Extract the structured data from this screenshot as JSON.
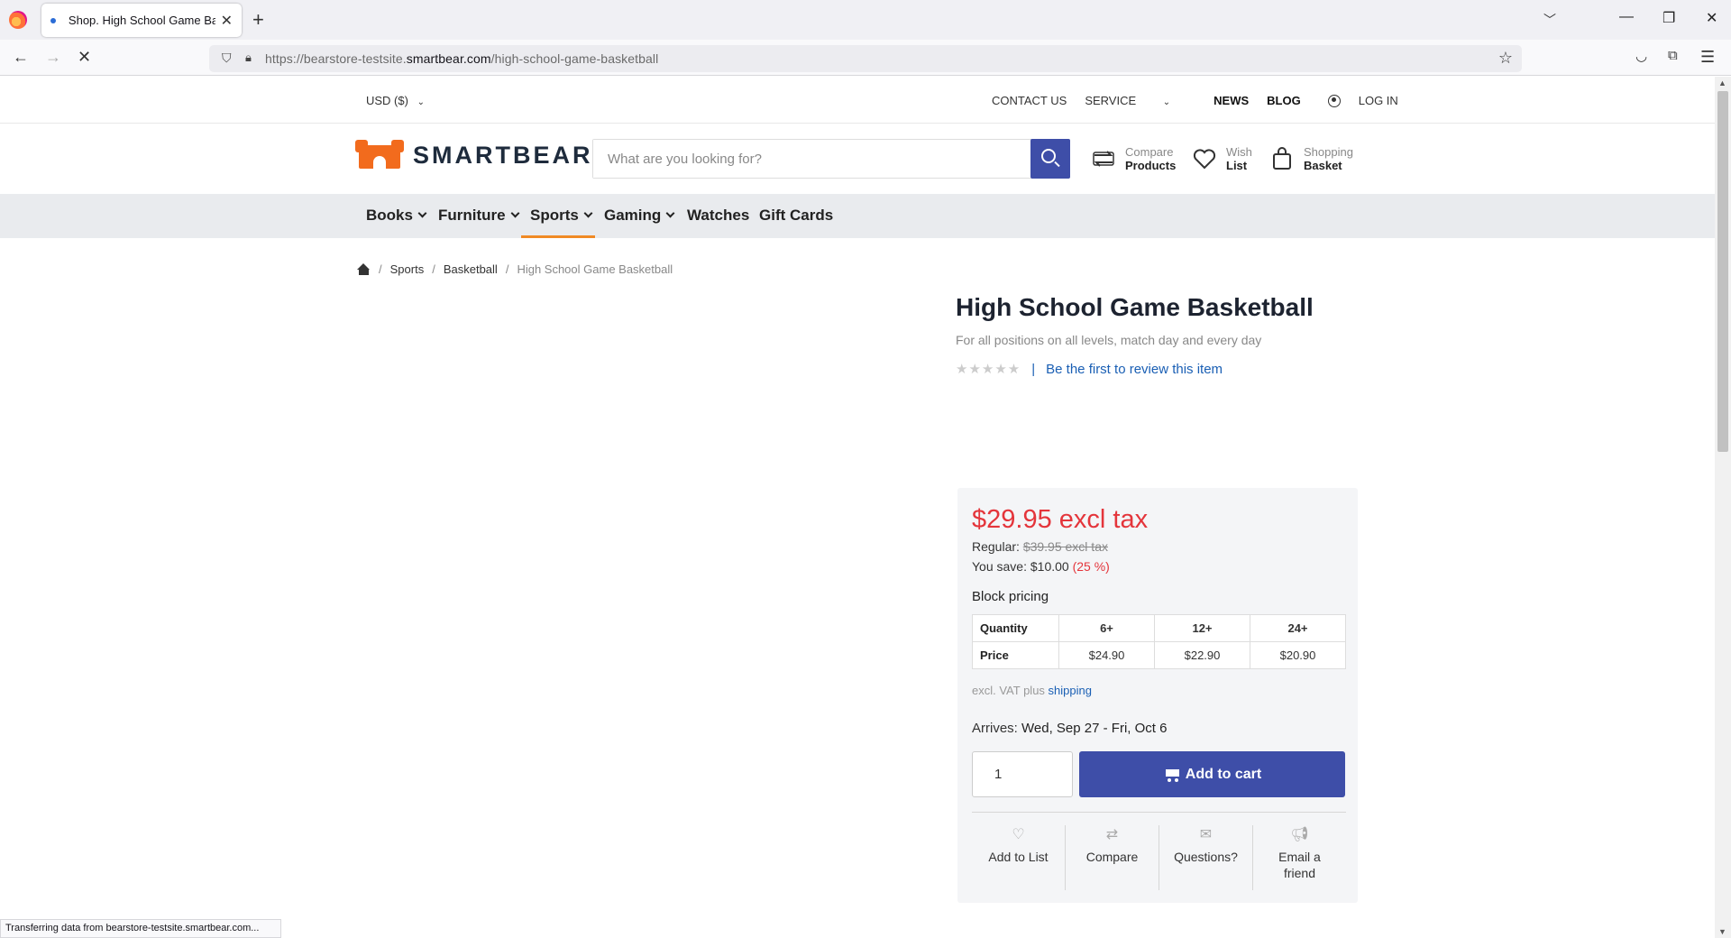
{
  "browser": {
    "tab_title": "Shop. High School Game Basketball",
    "url_prefix": "https://bearstore-testsite.",
    "url_domain": "smartbear.com",
    "url_path": "/high-school-game-basketball",
    "status_text": "Transferring data from bearstore-testsite.smartbear.com..."
  },
  "topbar": {
    "currency": "USD ($)",
    "contact": "CONTACT US",
    "service": "SERVICE",
    "news": "NEWS",
    "blog": "BLOG",
    "login": "LOG IN"
  },
  "header": {
    "logo_text": "SMARTBEAR",
    "search_placeholder": "What are you looking for?",
    "compare_l1": "Compare",
    "compare_l2": "Products",
    "wish_l1": "Wish",
    "wish_l2": "List",
    "basket_l1": "Shopping",
    "basket_l2": "Basket"
  },
  "categories": [
    "Books",
    "Furniture",
    "Sports",
    "Gaming",
    "Watches",
    "Gift Cards"
  ],
  "active_category": "Sports",
  "breadcrumb": [
    "Sports",
    "Basketball",
    "High School Game Basketball"
  ],
  "product": {
    "title": "High School Game Basketball",
    "subtitle": "For all positions on all levels, match day and every day",
    "rating": 0,
    "review_link": "Be the first to review this item",
    "price": "$29.95 excl tax",
    "regular_label": "Regular:",
    "regular_price": "$39.95 excl tax",
    "save_label": "You save:",
    "save_amount": "$10.00",
    "save_pct": "(25 %)",
    "block_pricing_title": "Block pricing",
    "tiers_header": [
      "Quantity",
      "6+",
      "12+",
      "24+"
    ],
    "tiers_price": [
      "Price",
      "$24.90",
      "$22.90",
      "$20.90"
    ],
    "vat_text": "excl. VAT plus",
    "shipping_link": "shipping",
    "arrives_label": "Arrives:",
    "arrives_value": "Wed, Sep 27 - Fri, Oct 6",
    "quantity": "1",
    "add_to_cart": "Add to cart",
    "actions": {
      "add_to_list": "Add to List",
      "compare": "Compare",
      "questions": "Questions?",
      "email_friend": "Email a friend"
    }
  },
  "colors": {
    "brand_orange": "#f26b1d",
    "primary_blue": "#3e4ea8",
    "price_red": "#e4353b",
    "link_blue": "#1a5fb4",
    "nav_bg": "#e9ebee"
  }
}
